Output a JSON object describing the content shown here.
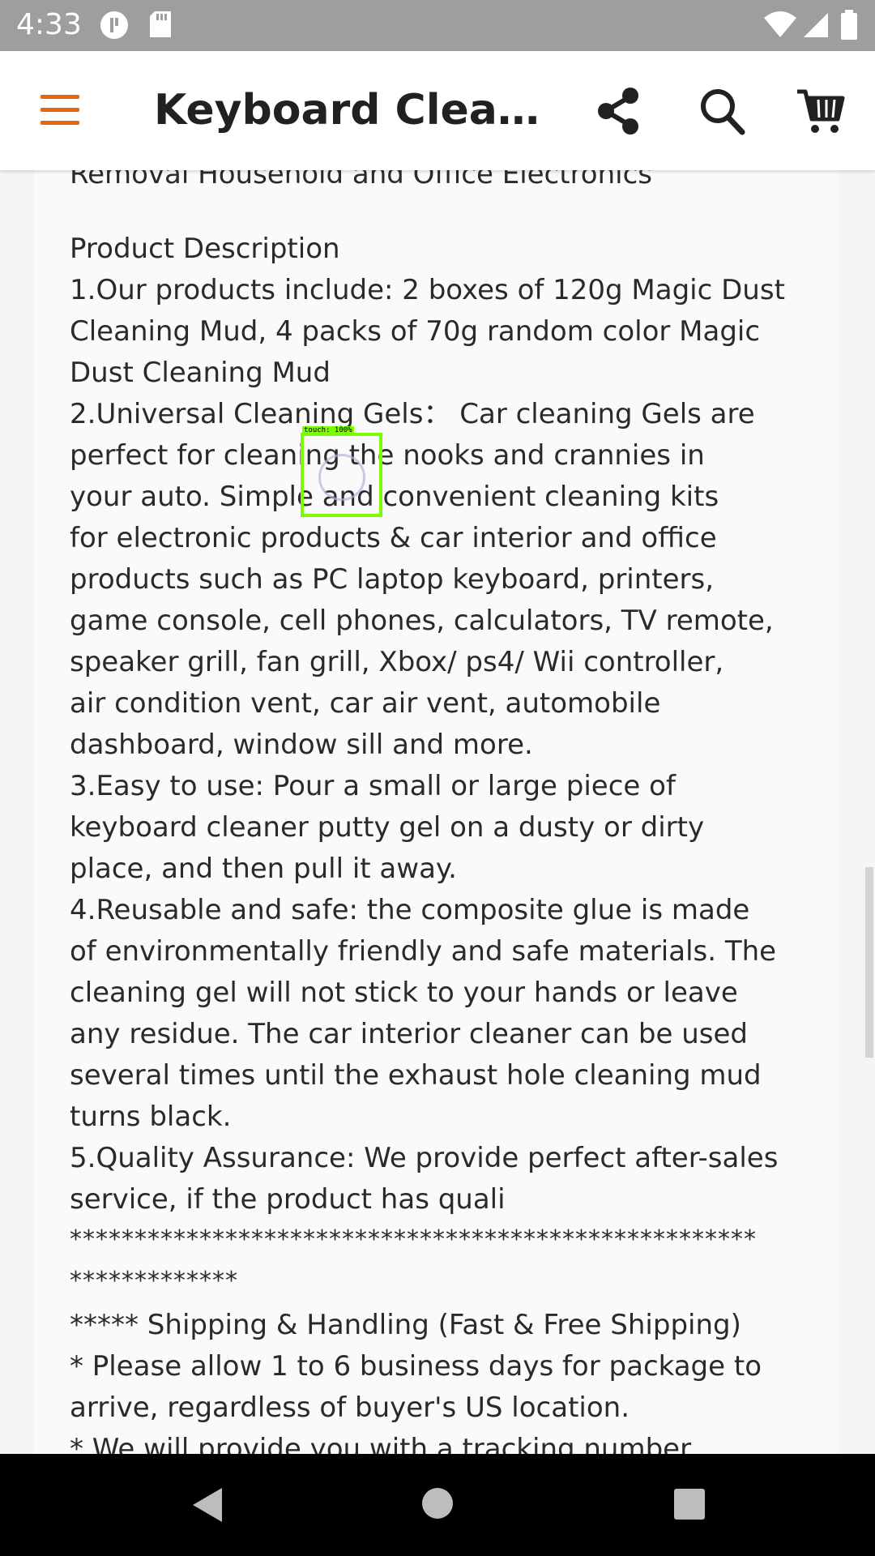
{
  "status_bar": {
    "time": "4:33",
    "icons_left": [
      "media-icon",
      "sd-card-icon"
    ],
    "icons_right": [
      "wifi-icon",
      "signal-icon",
      "battery-icon"
    ]
  },
  "app_bar": {
    "title": "Keyboard Cleaner Universal Dust Removal...",
    "accent_color": "#e8650f"
  },
  "description": {
    "clipped_line": "Removal Household and Office Electronics",
    "header": "Product Description",
    "lines": [
      "1.Our products include: 2 boxes of 120g Magic Dust",
      "Cleaning Mud, 4 packs of 70g random color Magic",
      "Dust Cleaning Mud",
      "2.Universal Cleaning Gels： Car cleaning Gels are",
      "perfect for cleaning the nooks and crannies in",
      "your auto. Simple and convenient cleaning kits",
      "for electronic products & car interior and office",
      "products such as PC laptop keyboard, printers,",
      "game console, cell phones, calculators, TV remote,",
      "speaker grill, fan grill, Xbox/ ps4/ Wii controller,",
      "air condition vent, car air vent, automobile",
      "dashboard, window sill and more.",
      "3.Easy to use: Pour a small or large piece of",
      "keyboard cleaner putty gel on a dusty or dirty",
      "place, and then pull it away.",
      "4.Reusable and safe: the composite glue is made",
      "of environmentally friendly and safe materials. The",
      "cleaning gel will not stick to your hands or leave",
      "any residue. The car interior cleaner can be used",
      "several times until the exhaust hole cleaning mud",
      "turns black.",
      "5.Quality Assurance: We provide perfect after-sales",
      "service, if the product has quali"
    ],
    "stars_line1": "*****************************************************",
    "stars_line2": "*************",
    "shipping_lines": [
      "***** Shipping & Handling (Fast & Free Shipping)",
      "* Please allow 1 to 6 business days for package to",
      "arrive, regardless of buyer's US location.",
      "* We will provide you with a tracking number"
    ]
  },
  "touch_indicator": {
    "label": "touch: 100%",
    "color": "#7cfc00"
  },
  "nav_bar": {
    "buttons": [
      "back-icon",
      "home-icon",
      "recents-icon"
    ]
  }
}
